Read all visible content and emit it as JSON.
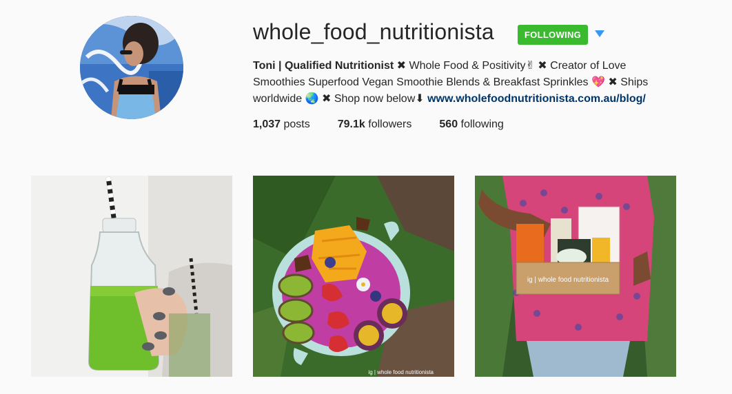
{
  "profile": {
    "username": "whole_food_nutritionista",
    "follow_button": "FOLLOWING",
    "bio": {
      "name": "Toni | Qualified Nutritionist",
      "part1": "Whole Food & Positivity",
      "emoji_victory": "✌",
      "part2": "Creator of Love Smoothies Superfood Vegan Smoothie Blends & Breakfast Sprinkles",
      "emoji_heart": "💖",
      "part3": "Ships worldwide",
      "emoji_globe": "🌏",
      "part4": "Shop now below",
      "arrow": "⬇",
      "separator": "✖",
      "link": "www.wholefoodnutritionista.com.au/blog/"
    },
    "stats": {
      "posts_count": "1,037",
      "posts_label": "posts",
      "followers_count": "79.1k",
      "followers_label": "followers",
      "following_count": "560",
      "following_label": "following"
    }
  },
  "photos": [
    {
      "subject": "green smoothie bottle"
    },
    {
      "subject": "smoothie bowl",
      "watermark": "ig | whole food nutritionista"
    },
    {
      "subject": "product box",
      "box_text": "ig | whole food nutritionista"
    }
  ],
  "colors": {
    "background": "#fafafa",
    "following_button": "#3aba2f",
    "link": "#003569",
    "dropdown": "#3897f0"
  }
}
